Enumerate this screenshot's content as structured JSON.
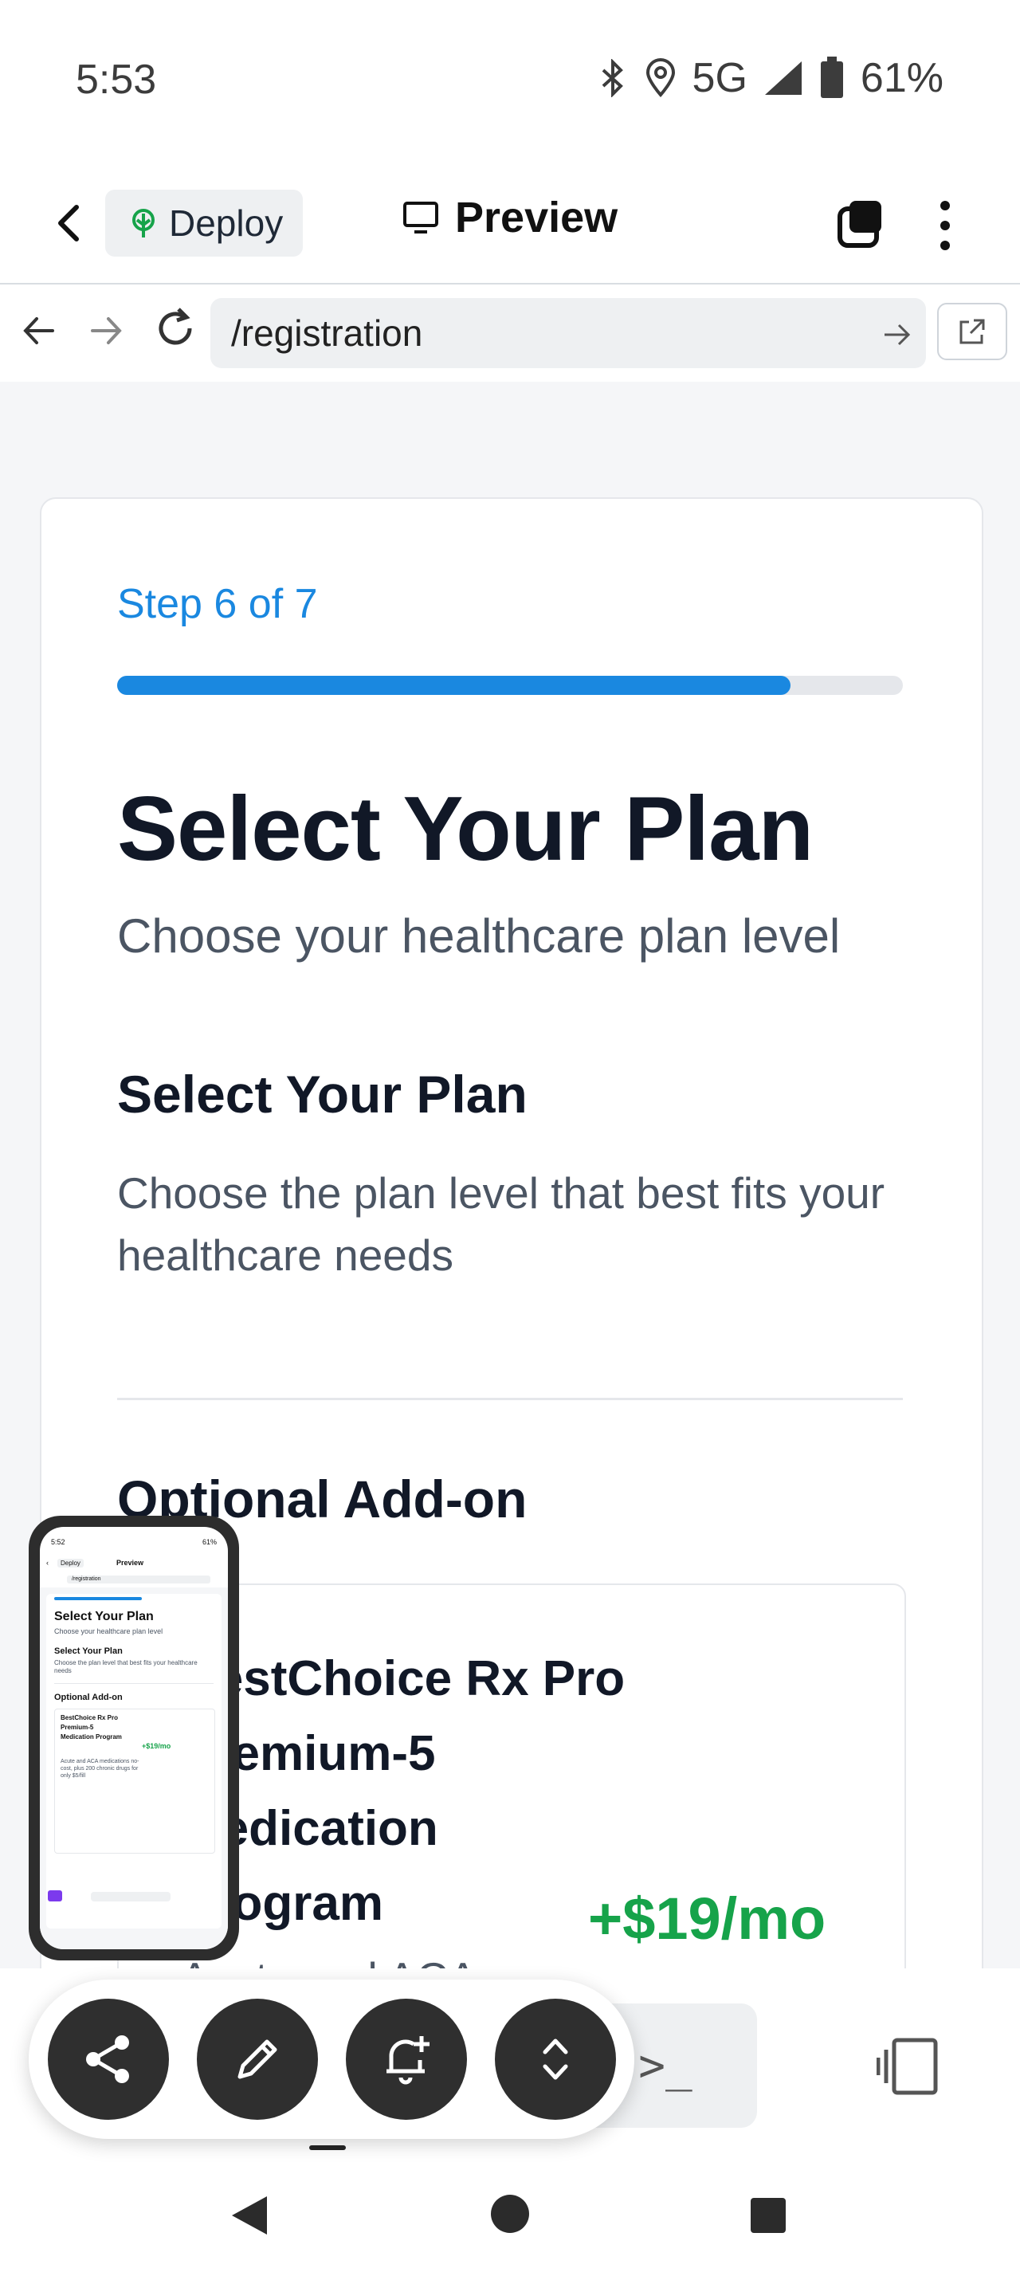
{
  "status_bar": {
    "time": "5:53",
    "network": "5G",
    "battery": "61%",
    "icons": [
      "bluetooth-icon",
      "location-icon",
      "signal-icon",
      "battery-icon"
    ]
  },
  "app_header": {
    "deploy_label": "Deploy",
    "preview_label": "Preview"
  },
  "browser": {
    "url": "/registration"
  },
  "registration": {
    "step_label": "Step 6 of 7",
    "progress": 0.857,
    "title": "Select Your Plan",
    "subtitle": "Choose your healthcare plan level",
    "section_title": "Select Your Plan",
    "section_desc": "Choose the plan level that best fits your healthcare needs",
    "addon_heading": "Optional Add-on",
    "addon": {
      "name": "BestChoice Rx Pro Premium-5 Medication Program",
      "price": "+$19/mo",
      "description_peek": "Acute and ACA"
    }
  },
  "mini_preview": {
    "time": "5:52",
    "battery": "61%",
    "deploy": "Deploy",
    "preview": "Preview",
    "url": "/registration",
    "title": "Select Your Plan",
    "subtitle": "Choose your healthcare plan level",
    "section_title": "Select Your Plan",
    "section_desc": "Choose the plan level that best fits your healthcare needs",
    "addon_heading": "Optional Add-on",
    "addon_name": "BestChoice Rx Pro Premium-5 Medication Program",
    "addon_price": "+$19/mo",
    "addon_desc": "Acute and ACA medications no-cost, plus 200 chronic drugs for only $5/fill"
  },
  "toolbar": {
    "terminal_label": ">_",
    "icons": [
      "share-icon",
      "edit-icon",
      "add-alert-icon",
      "expand-collapse-icon",
      "sidebar-toggle-icon"
    ]
  },
  "colors": {
    "accent": "#1a88e0",
    "price_green": "#16a34a",
    "title_text": "#111827",
    "muted_text": "#4b5563"
  }
}
